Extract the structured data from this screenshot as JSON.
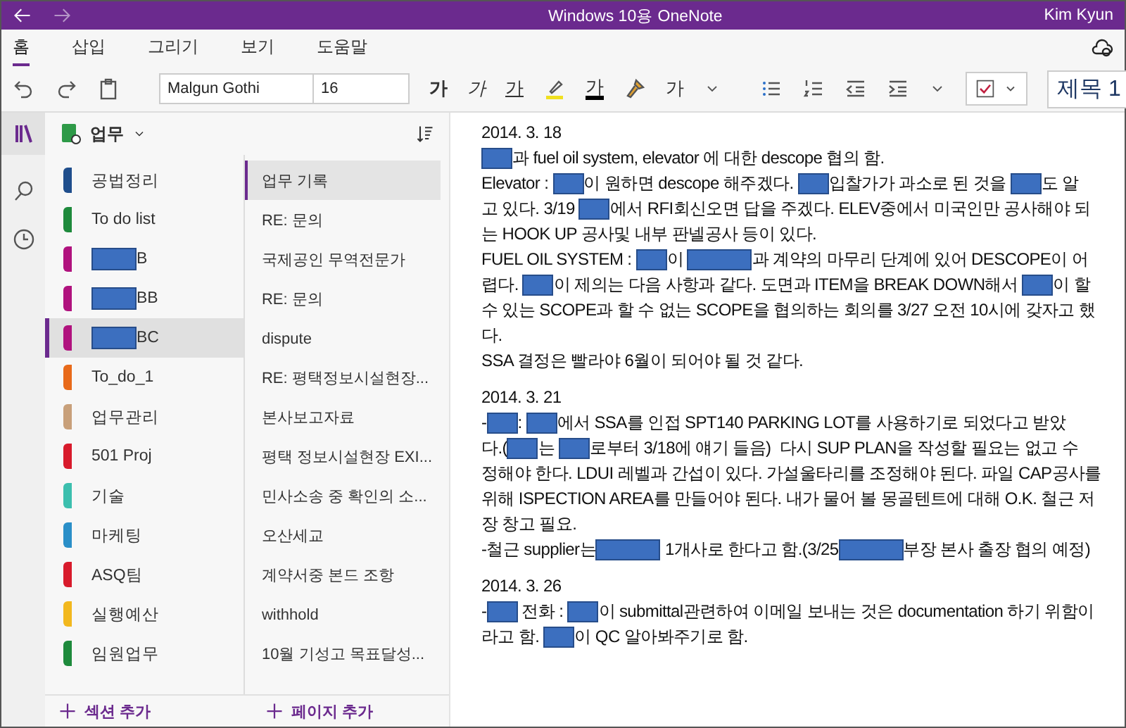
{
  "window": {
    "title": "Windows 10용 OneNote",
    "user": "Kim Kyun"
  },
  "ribbon_tabs": [
    {
      "label": "홈",
      "selected": true
    },
    {
      "label": "삽입",
      "selected": false
    },
    {
      "label": "그리기",
      "selected": false
    },
    {
      "label": "보기",
      "selected": false
    },
    {
      "label": "도움말",
      "selected": false
    }
  ],
  "toolbar": {
    "font": "Malgun Gothi",
    "size": "16",
    "bold": "가",
    "italic": "가",
    "underline": "가",
    "font_color": "가",
    "clear_format": "가",
    "style": "제목 1"
  },
  "notebook": {
    "name": "업무"
  },
  "sections": [
    {
      "label": "공법정리",
      "redacted": false,
      "color": "#1f4e8c",
      "selected": false
    },
    {
      "label": "To do list",
      "redacted": false,
      "color": "#1e8a3c",
      "selected": false
    },
    {
      "label": "B",
      "redacted": true,
      "color": "#b0127e",
      "selected": false
    },
    {
      "label": "BB",
      "redacted": true,
      "color": "#b0127e",
      "selected": false
    },
    {
      "label": "BC",
      "redacted": true,
      "color": "#b0127e",
      "selected": true
    },
    {
      "label": "To_do_1",
      "redacted": false,
      "color": "#e86a1a",
      "selected": false
    },
    {
      "label": "업무관리",
      "redacted": false,
      "color": "#c8a07a",
      "selected": false
    },
    {
      "label": "501 Proj",
      "redacted": false,
      "color": "#d81b2c",
      "selected": false
    },
    {
      "label": "기술",
      "redacted": false,
      "color": "#3cbfae",
      "selected": false
    },
    {
      "label": "마케팅",
      "redacted": false,
      "color": "#2a8fc8",
      "selected": false
    },
    {
      "label": "ASQ팀",
      "redacted": false,
      "color": "#d81b2c",
      "selected": false
    },
    {
      "label": "실행예산",
      "redacted": false,
      "color": "#f2b81e",
      "selected": false
    },
    {
      "label": "임원업무",
      "redacted": false,
      "color": "#1e8a3c",
      "selected": false
    }
  ],
  "pages": [
    {
      "label": "업무 기록",
      "selected": true
    },
    {
      "label": "RE: 문의",
      "selected": false
    },
    {
      "label": "국제공인 무역전문가",
      "selected": false
    },
    {
      "label": "RE: 문의",
      "selected": false
    },
    {
      "label": "dispute",
      "selected": false
    },
    {
      "label": "RE: 평택정보시설현장...",
      "selected": false
    },
    {
      "label": "본사보고자료",
      "selected": false
    },
    {
      "label": "평택 정보시설현장 EXI...",
      "selected": false
    },
    {
      "label": "민사소송 중 확인의 소...",
      "selected": false
    },
    {
      "label": "오산세교",
      "selected": false
    },
    {
      "label": "계약서중 본드 조항",
      "selected": false
    },
    {
      "label": "withhold",
      "selected": false
    },
    {
      "label": "10월 기성고 목표달성...",
      "selected": false
    }
  ],
  "add_section": "섹션 추가",
  "add_page": "페이지 추가",
  "note": [
    {
      "date": "2014. 3. 18",
      "lines": [
        [
          {
            "kind": "redaction"
          },
          {
            "kind": "text",
            "text": "과 fuel oil system, elevator 에 대한 descope 협의 함."
          }
        ],
        [
          {
            "kind": "text",
            "text": "Elevator : "
          },
          {
            "kind": "redaction"
          },
          {
            "kind": "text",
            "text": "이 원하면 descope 해주겠다. "
          },
          {
            "kind": "redaction"
          },
          {
            "kind": "text",
            "text": "입찰가가 과소로 된 것을 "
          },
          {
            "kind": "redaction"
          },
          {
            "kind": "text",
            "text": "도 알"
          }
        ],
        [
          {
            "kind": "text",
            "text": "고 있다. 3/19 "
          },
          {
            "kind": "redaction"
          },
          {
            "kind": "text",
            "text": "에서 RFI회신오면 답을 주겠다. ELEV중에서 미국인만 공사해야 되"
          }
        ],
        [
          {
            "kind": "text",
            "text": "는 HOOK UP 공사및 내부 판넬공사 등이 있다."
          }
        ],
        [
          {
            "kind": "text",
            "text": "FUEL OIL SYSTEM : "
          },
          {
            "kind": "redaction"
          },
          {
            "kind": "text",
            "text": "이 "
          },
          {
            "kind": "long_redaction"
          },
          {
            "kind": "text",
            "text": "과 계약의 마무리 단계에 있어 DESCOPE이 어"
          }
        ],
        [
          {
            "kind": "text",
            "text": "렵다. "
          },
          {
            "kind": "redaction"
          },
          {
            "kind": "text",
            "text": "이 제의는 다음 사항과 같다. 도면과 ITEM을 BREAK DOWN해서 "
          },
          {
            "kind": "redaction"
          },
          {
            "kind": "text",
            "text": "이 할"
          }
        ],
        [
          {
            "kind": "text",
            "text": "수 있는 SCOPE과 할 수 없는 SCOPE을 협의하는 회의를 3/27 오전 10시에 갖자고 했"
          }
        ],
        [
          {
            "kind": "text",
            "text": "다."
          }
        ],
        [
          {
            "kind": "text",
            "text": "SSA 결정은 빨라야 6월이 되어야 될 것 같다."
          }
        ]
      ]
    },
    {
      "date": "2014. 3. 21",
      "lines": [
        [
          {
            "kind": "text",
            "text": "-"
          },
          {
            "kind": "redaction"
          },
          {
            "kind": "text",
            "text": ": "
          },
          {
            "kind": "redaction"
          },
          {
            "kind": "text",
            "text": "에서 SSA를 인접 SPT140 PARKING LOT를 사용하기로 되었다고 받았"
          }
        ],
        [
          {
            "kind": "text",
            "text": "다.("
          },
          {
            "kind": "redaction"
          },
          {
            "kind": "text",
            "text": "는 "
          },
          {
            "kind": "redaction"
          },
          {
            "kind": "text",
            "text": "로부터 3/18에 얘기 들음)  다시 SUP PLAN을 작성할 필요는 없고 수"
          }
        ],
        [
          {
            "kind": "text",
            "text": "정해야 한다. LDUI 레벨과 간섭이 있다. 가설울타리를 조정해야 된다. 파일 CAP공사를"
          }
        ],
        [
          {
            "kind": "text",
            "text": "위해 ISPECTION AREA를 만들어야 된다. 내가 물어 볼 몽골텐트에 대해 O.K. 철근 저"
          }
        ],
        [
          {
            "kind": "text",
            "text": "장 창고 필요."
          }
        ],
        [
          {
            "kind": "text",
            "text": "-철근 supplier는"
          },
          {
            "kind": "long_redaction"
          },
          {
            "kind": "text",
            "text": " 1개사로 한다고 함.(3/25"
          },
          {
            "kind": "long_redaction"
          },
          {
            "kind": "text",
            "text": "부장 본사 출장 협의 예정)"
          }
        ]
      ]
    },
    {
      "date": "2014. 3. 26",
      "lines": [
        [
          {
            "kind": "text",
            "text": "-"
          },
          {
            "kind": "redaction"
          },
          {
            "kind": "text",
            "text": " 전화 : "
          },
          {
            "kind": "redaction"
          },
          {
            "kind": "text",
            "text": "이 submittal관련하여 이메일 보내는 것은 documentation 하기 위함이"
          }
        ],
        [
          {
            "kind": "text",
            "text": "라고 함. "
          },
          {
            "kind": "redaction"
          },
          {
            "kind": "text",
            "text": "이 QC 알아봐주기로 함."
          }
        ]
      ]
    }
  ]
}
